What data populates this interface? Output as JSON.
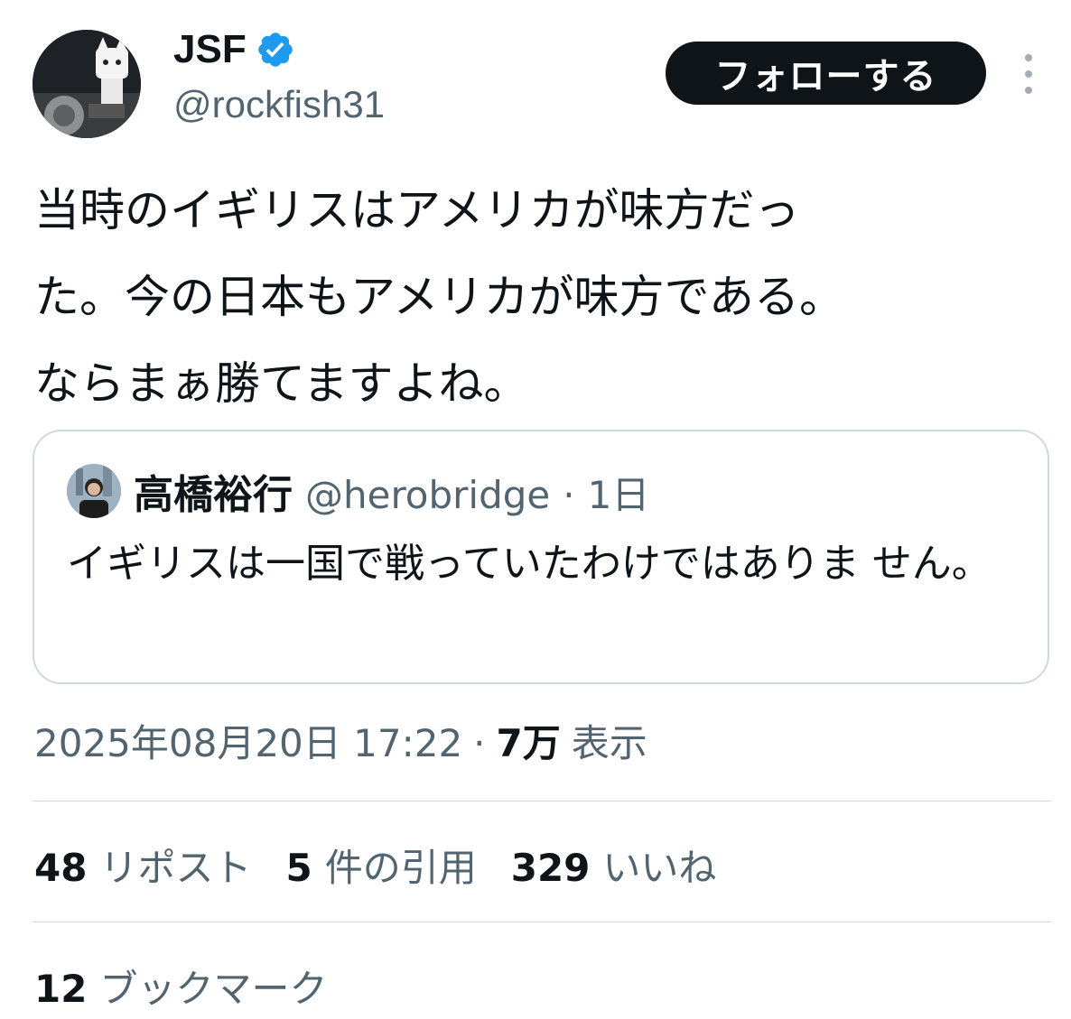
{
  "author": {
    "name": "JSF",
    "handle": "@rockfish31",
    "verified_icon": "verified-badge-icon",
    "avatar_icon": "profile-photo"
  },
  "follow_button": {
    "label": "フォローする"
  },
  "more_icon": "more-options-icon",
  "tweet": {
    "text": "当時のイギリスはアメリカが味方だっ\nた。今の日本もアメリカが味方である。\nならまぁ勝てますよね。"
  },
  "quote": {
    "name": "高橋裕行",
    "handle": "@herobridge",
    "dot": "·",
    "time": "1日",
    "text": "イギリスは一国で戦っていたわけではありま せん。"
  },
  "meta": {
    "timestamp": "2025年08月20日 17:22",
    "dot": "·",
    "views": "7万",
    "views_label": "表示"
  },
  "stats": {
    "reposts": {
      "count": "48",
      "label": "リポスト"
    },
    "quotes": {
      "count": "5",
      "label": "件の引用"
    },
    "likes": {
      "count": "329",
      "label": "いいね"
    }
  },
  "bookmarks": {
    "count": "12",
    "label": "ブックマーク"
  },
  "colors": {
    "primary_text": "#0f1419",
    "secondary_text": "#536471",
    "border": "#cfd9de",
    "verified_blue": "#1d9bf0",
    "button_bg": "#0f1419"
  }
}
